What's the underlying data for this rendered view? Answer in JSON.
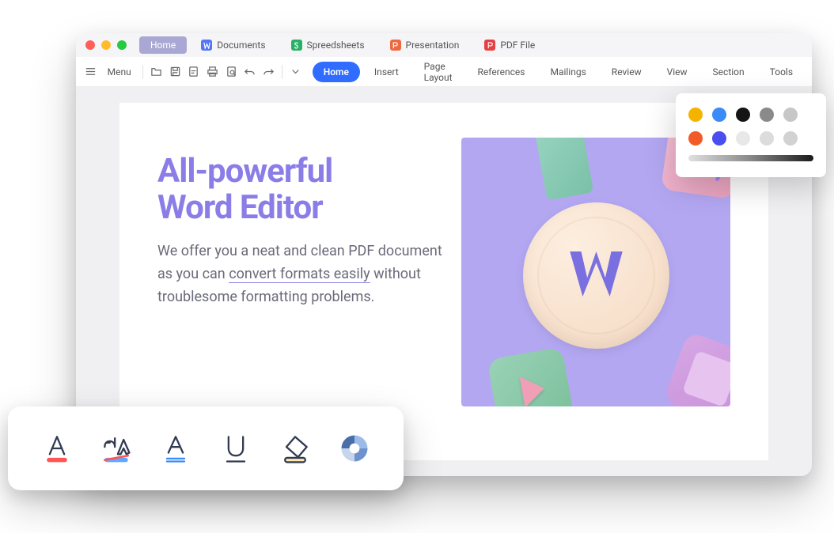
{
  "appTabs": [
    {
      "label": "Home",
      "active": true,
      "icon": "none"
    },
    {
      "label": "Documents",
      "icon": "w"
    },
    {
      "label": "Spreedsheets",
      "icon": "s"
    },
    {
      "label": "Presentation",
      "icon": "p"
    },
    {
      "label": "PDF File",
      "icon": "pdf"
    }
  ],
  "toolbar": {
    "menu_label": "Menu"
  },
  "ribbonTabs": [
    "Home",
    "Insert",
    "Page Layout",
    "References",
    "Mailings",
    "Review",
    "View",
    "Section",
    "Tools"
  ],
  "activeRibbonTab": "Home",
  "document": {
    "title_line1": "All-powerful",
    "title_line2": "Word Editor",
    "body_pre": "We offer you a neat and clean PDF document as you can ",
    "body_underlined": "convert formats easily",
    "body_post": " without troublesome formatting problems."
  },
  "colorPanel": {
    "row1": [
      "#f5b301",
      "#3a8af7",
      "#151515",
      "#8a8a8a",
      "#c7c7c7"
    ],
    "row2": [
      "#f25a2a",
      "#4a4ef0",
      "#e8e8e8",
      "#dcdcdc",
      "#d2d2d2"
    ]
  },
  "formatTools": [
    "text-color",
    "highlighter",
    "text-outline",
    "underline",
    "eraser",
    "shapes"
  ]
}
